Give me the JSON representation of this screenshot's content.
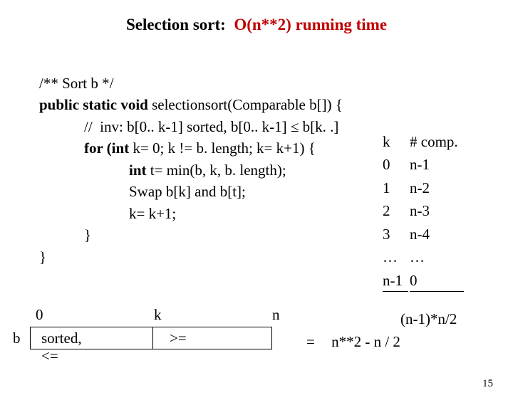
{
  "title": {
    "prefix": "Selection sort:",
    "complexity": "O(n**2) running time"
  },
  "code": {
    "l1": "/** Sort b */",
    "l2a": "public static void",
    "l2b": " selectionsort(Comparable b[]) {",
    "l3": "            //  inv: b[0.. k-1] sorted, b[0.. k-1] ≤ b[k. .]",
    "l4a": "            for (int",
    "l4b": " k= 0; k != b. length; k= k+1) {",
    "l5a": "                        int",
    "l5b": " t= min(b, k, b. length);",
    "l6": "                        Swap b[k] and b[t];",
    "l7": "                        k= k+1;",
    "l8": "            }",
    "l9": "}"
  },
  "comp_table": {
    "head_k": "k",
    "head_c": "# comp.",
    "rows": [
      {
        "k": "0",
        "c": "n-1"
      },
      {
        "k": "1",
        "c": "n-2"
      },
      {
        "k": "2",
        "c": "n-3"
      },
      {
        "k": "3",
        "c": "n-4"
      },
      {
        "k": "…",
        "c": "…"
      },
      {
        "k": "n-1",
        "c": "0"
      }
    ]
  },
  "diagram": {
    "idx0": "0",
    "idxk": "k",
    "idxn": "n",
    "arr": "b",
    "left": "sorted, <=",
    "right": ">="
  },
  "eq": {
    "sum": "(n-1)*n/2",
    "eq": "=",
    "closed": "n**2 - n / 2"
  },
  "pagenum": "15"
}
